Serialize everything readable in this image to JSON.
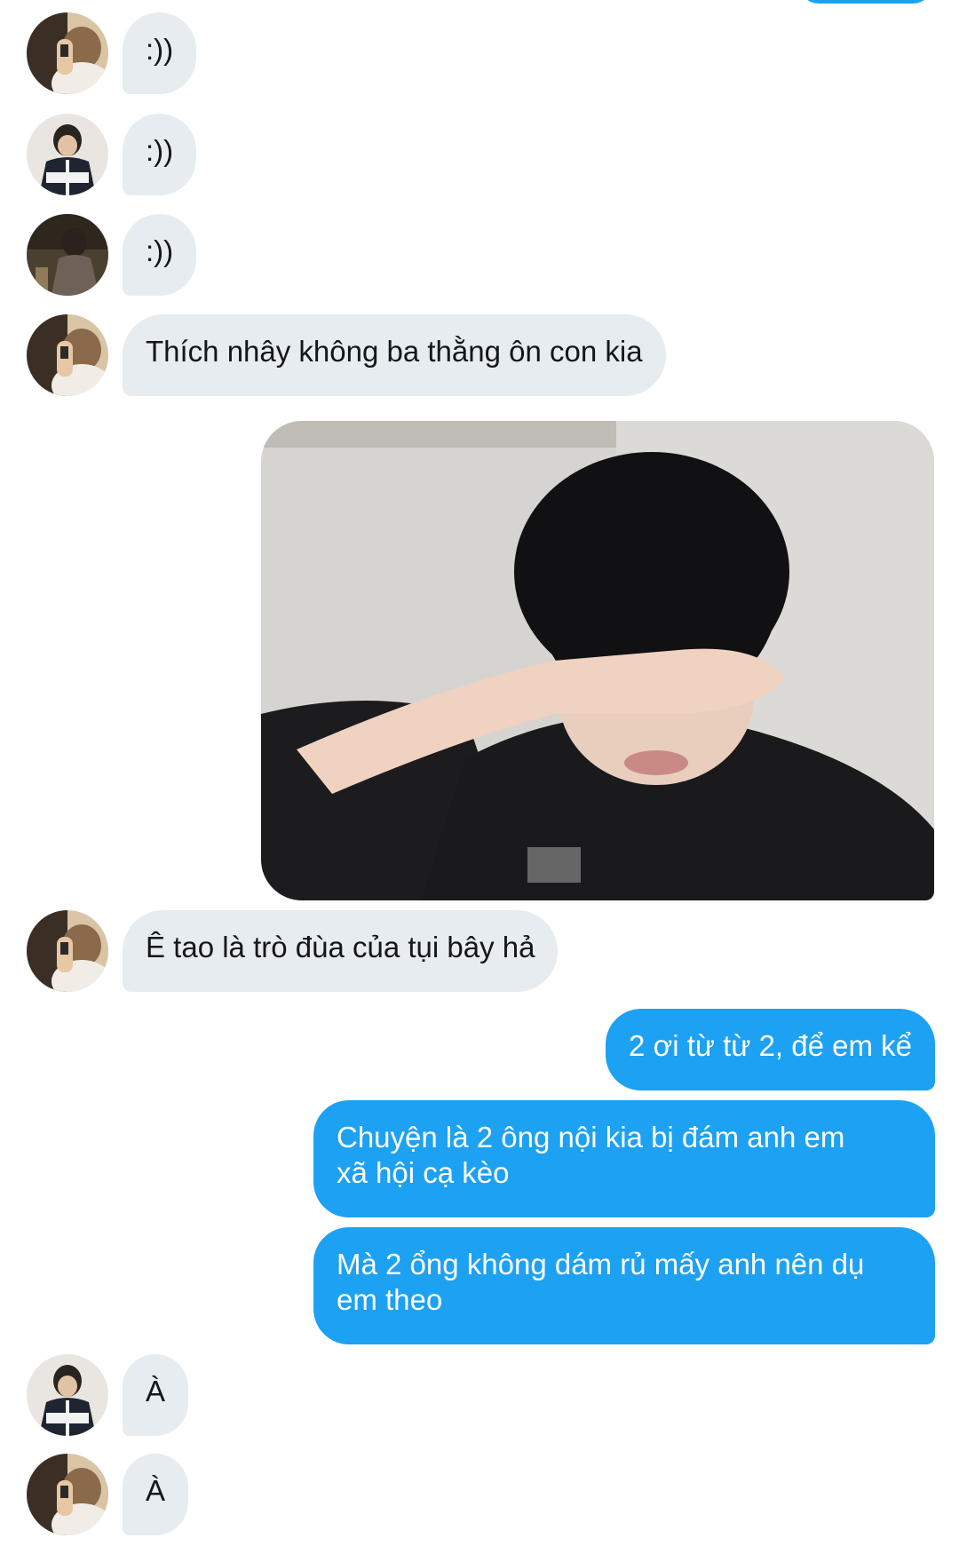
{
  "colors": {
    "incoming_bubble": "#e6ecf0",
    "outgoing_bubble": "#1da1f2",
    "incoming_text": "#14171a",
    "outgoing_text": "#ffffff"
  },
  "messages": [
    {
      "id": 1,
      "direction": "incoming",
      "avatar": "avatar-hand-photo",
      "text": ":))"
    },
    {
      "id": 2,
      "direction": "incoming",
      "avatar": "avatar-jacket-photo",
      "text": ":))"
    },
    {
      "id": 3,
      "direction": "incoming",
      "avatar": "avatar-dark-photo",
      "text": ":))"
    },
    {
      "id": 4,
      "direction": "incoming",
      "avatar": "avatar-hand-photo",
      "text": "Thích nhây không ba thằng ôn con kia"
    },
    {
      "id": 5,
      "direction": "outgoing",
      "type": "image",
      "image": "crying-boy-photo"
    },
    {
      "id": 6,
      "direction": "incoming",
      "avatar": "avatar-hand-photo",
      "text": "Ê tao là trò đùa của tụi bây hả"
    },
    {
      "id": 7,
      "direction": "outgoing",
      "text": "2 ơi từ từ 2, để em kể"
    },
    {
      "id": 8,
      "direction": "outgoing",
      "text_line1": "Chuyện là 2 ông nội kia bị đám anh em",
      "text_line2": "xã hội cạ kèo"
    },
    {
      "id": 9,
      "direction": "outgoing",
      "text_line1": "Mà 2 ổng không dám rủ mấy anh nên dụ",
      "text_line2": "em theo"
    },
    {
      "id": 10,
      "direction": "incoming",
      "avatar": "avatar-jacket-photo",
      "text": "À"
    },
    {
      "id": 11,
      "direction": "incoming",
      "avatar": "avatar-hand-photo",
      "text": "À"
    }
  ]
}
